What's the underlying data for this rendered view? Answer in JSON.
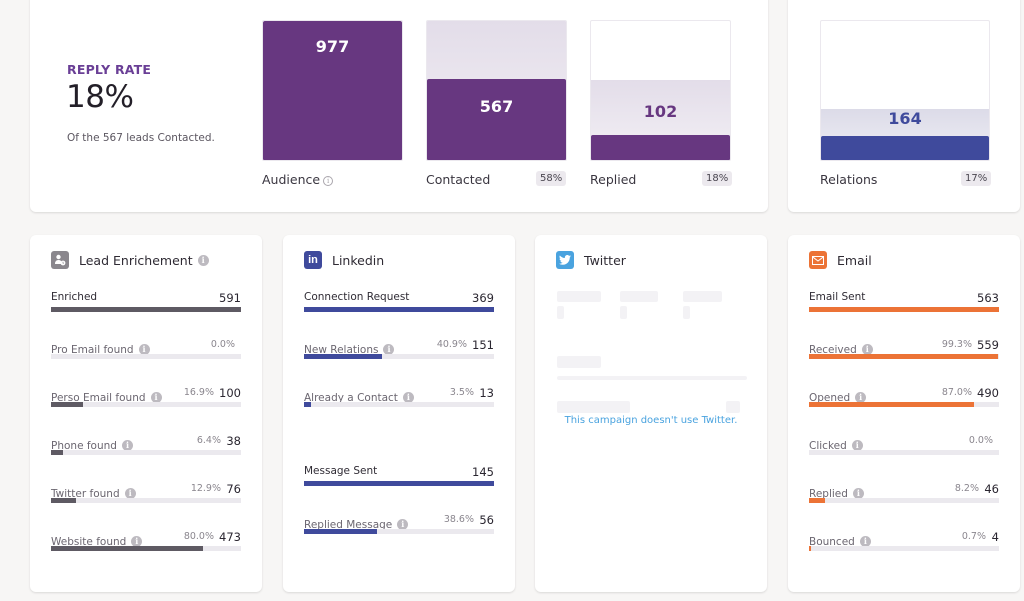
{
  "colors": {
    "purple": "#673780",
    "indigo": "#3f4a9c",
    "orange": "#ec7336",
    "gray_bar": "#5e5a63",
    "twitter_blue": "#4aa3df",
    "linkedin_blue": "#3f4a9c",
    "enrich_gray": "#8a878d"
  },
  "reply_rate": {
    "label": "REPLY RATE",
    "value": "18%",
    "subtitle": "Of the 567 leads Contacted."
  },
  "funnel": [
    {
      "key": "audience",
      "label": "Audience",
      "value": "977",
      "fraction": 1.0,
      "badge": null,
      "info": true
    },
    {
      "key": "contacted",
      "label": "Contacted",
      "value": "567",
      "fraction": 0.58,
      "badge": "58%",
      "info": false
    },
    {
      "key": "replied",
      "label": "Replied",
      "value": "102",
      "fraction": 0.18,
      "badge": "18%",
      "info": false
    }
  ],
  "relations": {
    "label": "Relations",
    "value": "164",
    "fraction": 0.17,
    "badge": "17%"
  },
  "lead_enrichment": {
    "title": "Lead Enrichement",
    "icon": "user-clock-icon",
    "metrics": [
      {
        "name": "Enriched",
        "pct": null,
        "value": "591",
        "fraction": 1.0,
        "main": true,
        "info": false
      },
      {
        "name": "Pro Email found",
        "pct": "0.0%",
        "value": null,
        "fraction": 0.0,
        "main": false,
        "info": true
      },
      {
        "name": "Perso Email found",
        "pct": "16.9%",
        "value": "100",
        "fraction": 0.169,
        "main": false,
        "info": true
      },
      {
        "name": "Phone found",
        "pct": "6.4%",
        "value": "38",
        "fraction": 0.064,
        "main": false,
        "info": true
      },
      {
        "name": "Twitter found",
        "pct": "12.9%",
        "value": "76",
        "fraction": 0.129,
        "main": false,
        "info": true
      },
      {
        "name": "Website found",
        "pct": "80.0%",
        "value": "473",
        "fraction": 0.8,
        "main": false,
        "info": true
      }
    ]
  },
  "linkedin": {
    "title": "Linkedin",
    "icon": "linkedin-icon",
    "metrics": [
      {
        "name": "Connection Request",
        "pct": null,
        "value": "369",
        "fraction": 1.0,
        "main": true,
        "info": false
      },
      {
        "name": "New Relations",
        "pct": "40.9%",
        "value": "151",
        "fraction": 0.409,
        "main": false,
        "info": true
      },
      {
        "name": "Already a Contact",
        "pct": "3.5%",
        "value": "13",
        "fraction": 0.035,
        "main": false,
        "info": true
      },
      {
        "name": "Message Sent",
        "pct": null,
        "value": "145",
        "fraction": 1.0,
        "main": true,
        "info": false
      },
      {
        "name": "Replied Message",
        "pct": "38.6%",
        "value": "56",
        "fraction": 0.386,
        "main": false,
        "info": true
      }
    ]
  },
  "twitter": {
    "title": "Twitter",
    "icon": "twitter-icon",
    "message": "This campaign doesn't use Twitter."
  },
  "email": {
    "title": "Email",
    "icon": "envelope-icon",
    "metrics": [
      {
        "name": "Email Sent",
        "pct": null,
        "value": "563",
        "fraction": 1.0,
        "main": true,
        "info": false
      },
      {
        "name": "Received",
        "pct": "99.3%",
        "value": "559",
        "fraction": 0.993,
        "main": false,
        "info": true
      },
      {
        "name": "Opened",
        "pct": "87.0%",
        "value": "490",
        "fraction": 0.87,
        "main": false,
        "info": true
      },
      {
        "name": "Clicked",
        "pct": "0.0%",
        "value": null,
        "fraction": 0.0,
        "main": false,
        "info": true
      },
      {
        "name": "Replied",
        "pct": "8.2%",
        "value": "46",
        "fraction": 0.082,
        "main": false,
        "info": true
      },
      {
        "name": "Bounced",
        "pct": "0.7%",
        "value": "4",
        "fraction": 0.007,
        "main": false,
        "info": true
      }
    ]
  }
}
